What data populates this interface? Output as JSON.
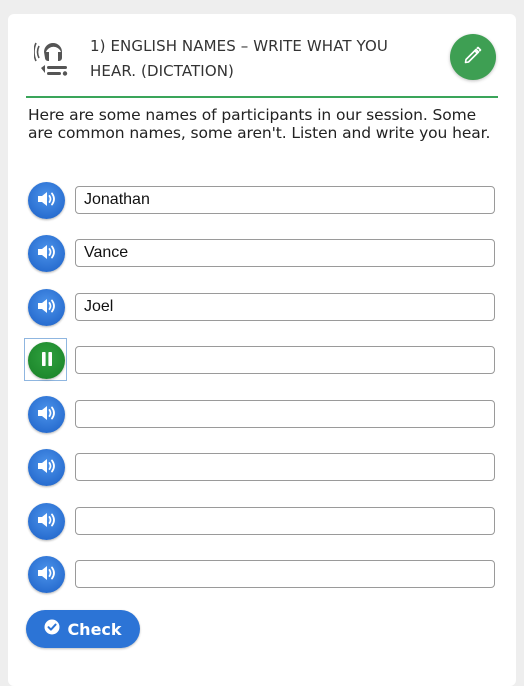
{
  "exercise": {
    "icon": "audio-dictation-icon",
    "title": "1) ENGLISH NAMES – WRITE WHAT YOU HEAR. (DICTATION)",
    "edit_icon": "pencil-icon",
    "instructions": "Here are some names of participants in our session. Some are common names, some aren't. Listen and write you hear."
  },
  "items": [
    {
      "icon": "speaker-icon",
      "state": "idle",
      "value": "Jonathan"
    },
    {
      "icon": "speaker-icon",
      "state": "idle",
      "value": "Vance"
    },
    {
      "icon": "speaker-icon",
      "state": "idle",
      "value": "Joel"
    },
    {
      "icon": "pause-icon",
      "state": "playing",
      "value": ""
    },
    {
      "icon": "speaker-icon",
      "state": "idle",
      "value": ""
    },
    {
      "icon": "speaker-icon",
      "state": "idle",
      "value": ""
    },
    {
      "icon": "speaker-icon",
      "state": "idle",
      "value": ""
    },
    {
      "icon": "speaker-icon",
      "state": "idle",
      "value": ""
    }
  ],
  "check_button": {
    "icon": "checkmark-circle-icon",
    "label": "Check"
  },
  "colors": {
    "accent_blue": "#2c74d6",
    "accent_green": "#3e9f53",
    "divider": "#3aa55a"
  }
}
